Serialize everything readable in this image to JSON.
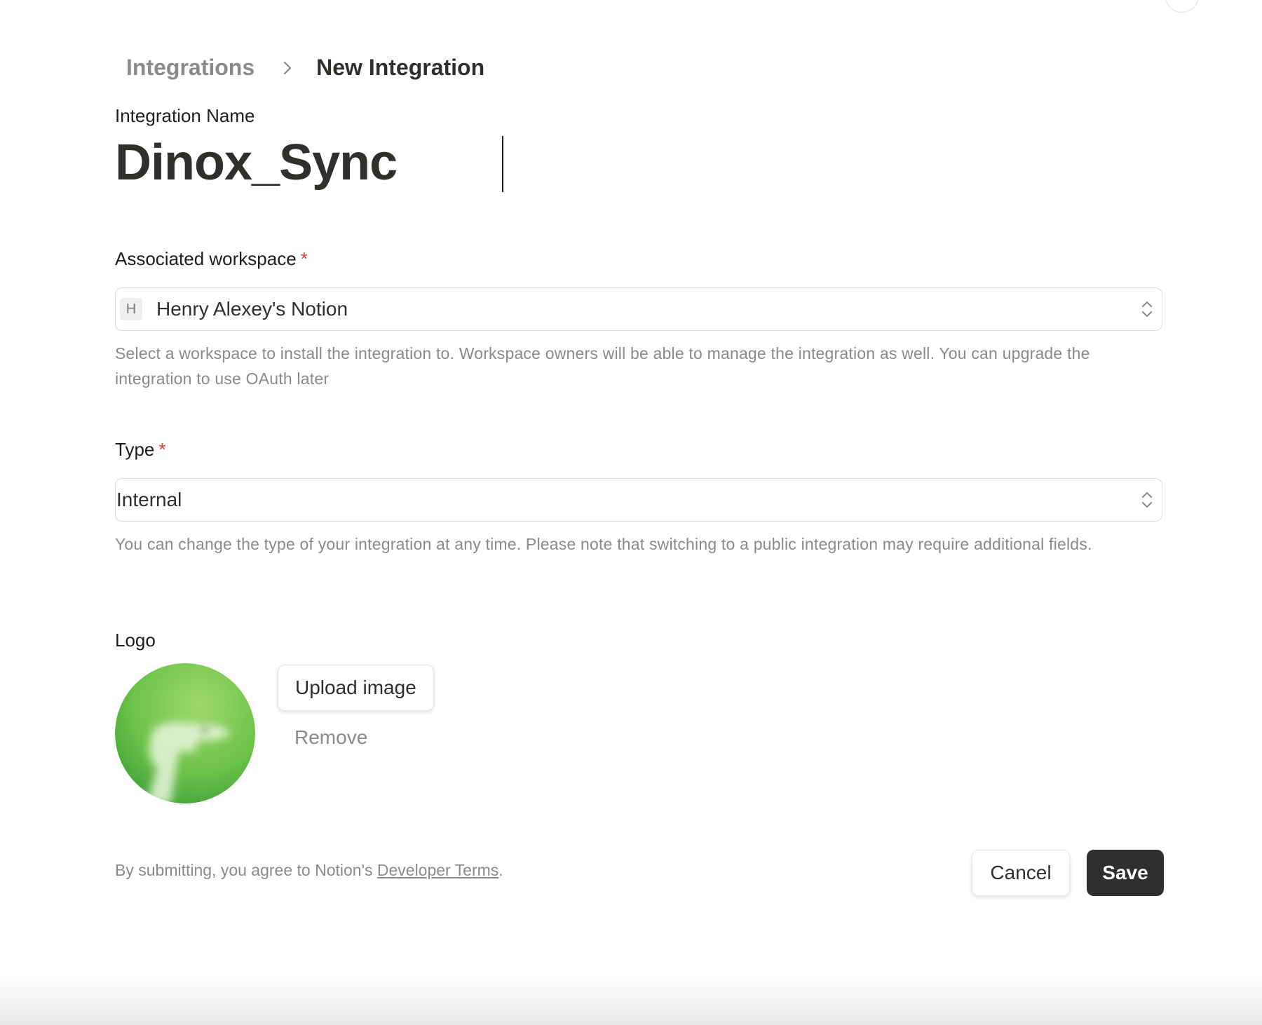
{
  "breadcrumb": {
    "root": "Integrations",
    "current": "New Integration"
  },
  "integration_name": {
    "label": "Integration Name",
    "value": "Dinox_Sync"
  },
  "workspace": {
    "label": "Associated workspace",
    "required_mark": "*",
    "badge": "H",
    "selected": "Henry Alexey's Notion",
    "help": "Select a workspace to install the integration to. Workspace owners will be able to manage the integration as well. You can upgrade the integration to use OAuth later"
  },
  "type": {
    "label": "Type",
    "required_mark": "*",
    "selected": "Internal",
    "help": "You can change the type of your integration at any time. Please note that switching to a public integration may require additional fields."
  },
  "logo": {
    "label": "Logo",
    "upload_label": "Upload image",
    "remove_label": "Remove"
  },
  "footer": {
    "terms_prefix": "By submitting, you agree to Notion's ",
    "terms_link": "Developer Terms",
    "terms_suffix": ".",
    "cancel_label": "Cancel",
    "save_label": "Save"
  },
  "icons": {
    "breadcrumb_separator": "chevron-right-icon",
    "select_arrows": "chevron-up-down-icon"
  },
  "colors": {
    "required": "#e03e3e",
    "primary_button": "#2f2f2f",
    "muted_text": "#8a8a87",
    "logo_green": "#6cc24a"
  }
}
